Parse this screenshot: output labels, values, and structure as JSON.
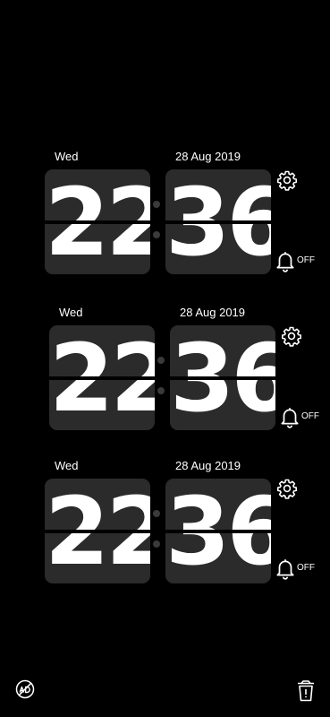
{
  "clocks": [
    {
      "day": "Wed",
      "date": "28 Aug 2019",
      "hours": "22",
      "minutes": "36",
      "alarm_status": "OFF"
    },
    {
      "day": "Wed",
      "date": "28 Aug 2019",
      "hours": "22",
      "minutes": "36",
      "alarm_status": "OFF"
    },
    {
      "day": "Wed",
      "date": "28 Aug 2019",
      "hours": "22",
      "minutes": "36",
      "alarm_status": "OFF"
    }
  ],
  "icons": {
    "settings": "gear-icon",
    "alarm": "bell-icon",
    "no_ads": "no-ads-icon",
    "delete": "trash-icon"
  },
  "colors": {
    "background": "#000000",
    "card": "#2b2b2b",
    "text": "#ffffff"
  }
}
